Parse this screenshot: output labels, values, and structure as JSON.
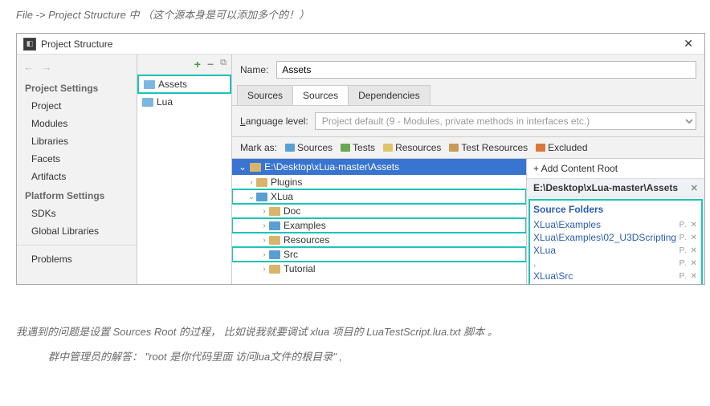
{
  "captions": {
    "top": "File -> Project Structure 中  （这个源本身是可以添加多个的！）",
    "mid": "我遇到的问题是设置  Sources Root 的过程，  比如说我就要调试  xlua 项目的 LuaTestScript.lua.txt 脚本 。",
    "bottom": "群中管理员的解答：  \"root 是你代码里面 访问lua文件的根目录\"  ,"
  },
  "window": {
    "title": "Project Structure",
    "close": "✕"
  },
  "sidebar": {
    "section1": "Project Settings",
    "items1": [
      "Project",
      "Modules",
      "Libraries",
      "Facets",
      "Artifacts"
    ],
    "section2": "Platform Settings",
    "items2": [
      "SDKs",
      "Global Libraries"
    ],
    "problems": "Problems"
  },
  "midtree": {
    "assets": "Assets",
    "lua": "Lua"
  },
  "main": {
    "name_label": "Name:",
    "name_value": "Assets",
    "tabs": [
      "Sources",
      "Sources",
      "Dependencies"
    ],
    "lang_label": "Language level:",
    "lang_value": "Project default (9 - Modules, private methods in interfaces etc.)",
    "mark_label": "Mark as:",
    "marks": [
      {
        "label": "Sources",
        "color": "#5a9fd4"
      },
      {
        "label": "Tests",
        "color": "#6aa84f"
      },
      {
        "label": "Resources",
        "color": "#e0c36a"
      },
      {
        "label": "Test Resources",
        "color": "#c89a5a"
      },
      {
        "label": "Excluded",
        "color": "#d87a3c"
      }
    ]
  },
  "tree": {
    "root": "E:\\Desktop\\xLua-master\\Assets",
    "nodes": [
      {
        "label": "Plugins",
        "indent": 1,
        "chev": ">",
        "hl": false
      },
      {
        "label": "XLua",
        "indent": 1,
        "chev": "v",
        "hl": true,
        "src": true
      },
      {
        "label": "Doc",
        "indent": 2,
        "chev": ">",
        "hl": false
      },
      {
        "label": "Examples",
        "indent": 2,
        "chev": ">",
        "hl": true,
        "src": true
      },
      {
        "label": "Resources",
        "indent": 2,
        "chev": ">",
        "hl": false
      },
      {
        "label": "Src",
        "indent": 2,
        "chev": ">",
        "hl": true,
        "src": true
      },
      {
        "label": "Tutorial",
        "indent": 2,
        "chev": ">",
        "hl": false
      }
    ]
  },
  "rightpane": {
    "add": "+ Add Content Root",
    "path": "E:\\Desktop\\xLua-master\\Assets",
    "src_title": "Source Folders",
    "items": [
      "XLua\\Examples",
      "XLua\\Examples\\02_U3DScripting",
      "XLua",
      ".",
      "XLua\\Src"
    ],
    "act": "P. ✕"
  }
}
